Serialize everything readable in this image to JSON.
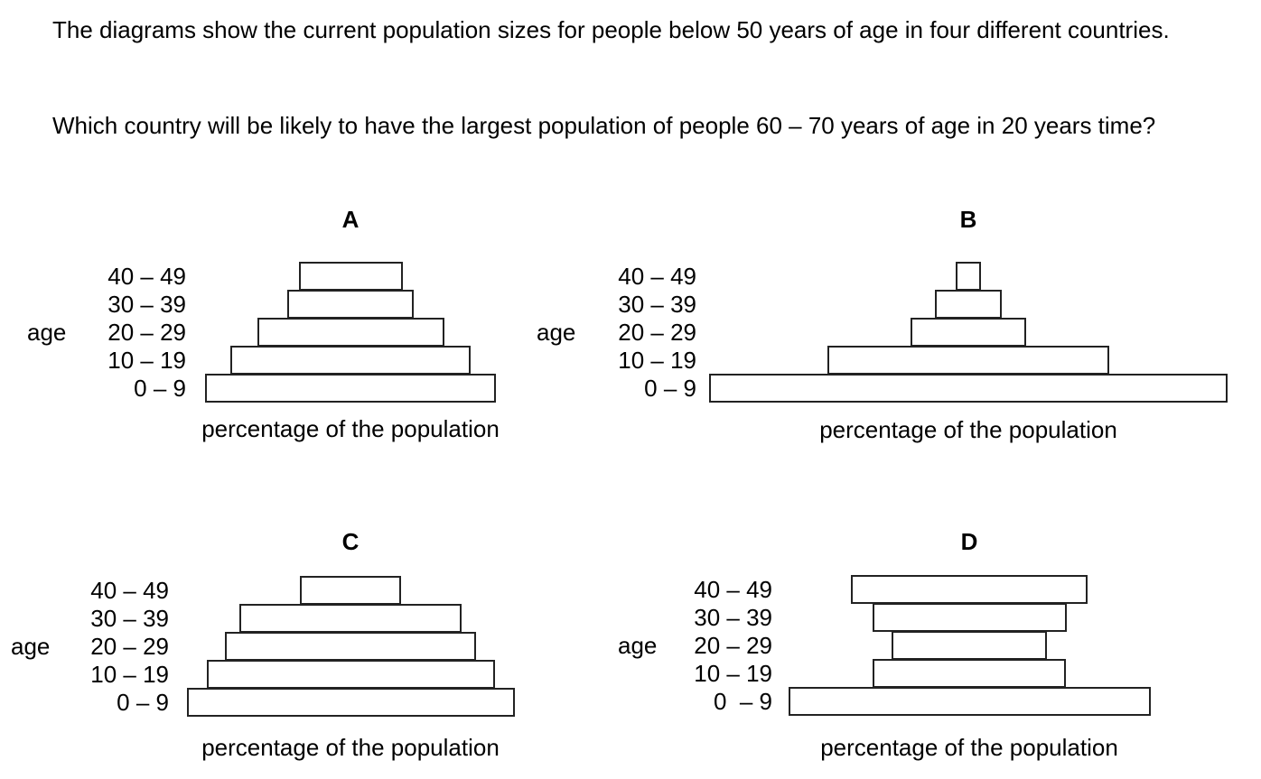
{
  "question": {
    "line1": "The diagrams show the current population sizes for people below 50 years of age in four different countries.",
    "line2": "Which country will be likely to have the largest population of people 60 – 70 years of age in 20 years time?"
  },
  "chart_data": [
    {
      "type": "bar",
      "title": "A",
      "ylabel": "age",
      "xlabel": "percentage of the population",
      "categories": [
        "0 – 9",
        "10 – 19",
        "20 – 29",
        "30 – 39",
        "40 – 49"
      ],
      "values": [
        322,
        266,
        207,
        140,
        115
      ]
    },
    {
      "type": "bar",
      "title": "B",
      "ylabel": "age",
      "xlabel": "percentage of the population",
      "categories": [
        "0 – 9",
        "10 – 19",
        "20 – 29",
        "30 – 39",
        "40 – 49"
      ],
      "values": [
        574,
        312,
        128,
        74,
        28
      ]
    },
    {
      "type": "bar",
      "title": "C",
      "ylabel": "age",
      "xlabel": "percentage of the population",
      "categories": [
        "0 – 9",
        "10 – 19",
        "20 – 29",
        "30 – 39",
        "40 – 49"
      ],
      "values": [
        363,
        319,
        278,
        246,
        112
      ]
    },
    {
      "type": "bar",
      "title": "D",
      "ylabel": "age",
      "xlabel": "percentage of the population",
      "categories": [
        "0  – 9",
        "10 – 19",
        "20 – 29",
        "30 – 39",
        "40 – 49"
      ],
      "values": [
        401,
        214,
        172,
        215,
        262
      ]
    }
  ]
}
